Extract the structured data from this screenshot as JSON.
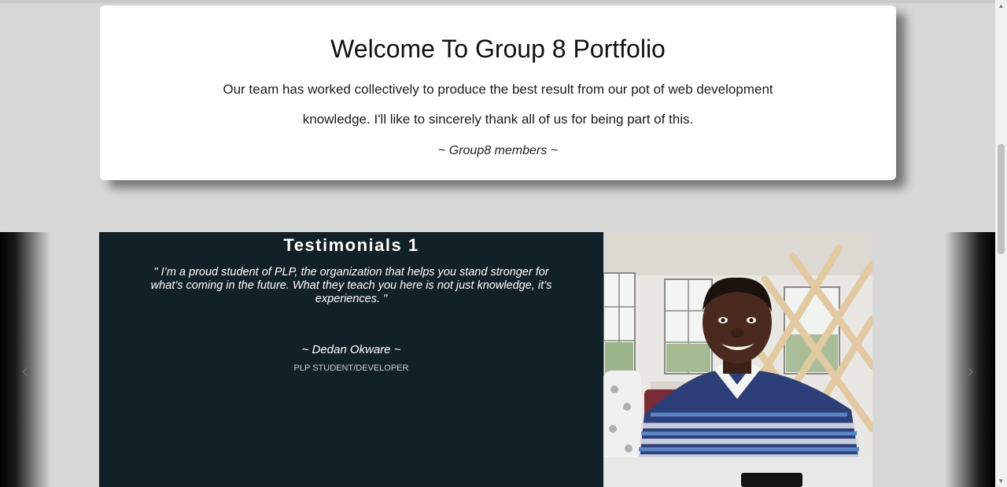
{
  "welcome": {
    "title": "Welcome To Group 8 Portfolio",
    "text": "Our team has worked collectively to produce the best result from our pot of web development knowledge. I'll like to sincerely thank all of us for being part of this.",
    "signature": "~ Group8 members ~"
  },
  "testimonial": {
    "title": "Testimonials 1",
    "quote": "\" I’m a proud student of PLP, the organization that helps you stand stronger for what’s coming in the future. What they teach you here is not just knowledge, it’s experiences. \"",
    "author": "~ Dedan Okware ~",
    "role": "PLP STUDENT/DEVELOPER"
  },
  "carousel": {
    "prev_icon": "chevron-left-icon",
    "next_icon": "chevron-right-icon",
    "prev_glyph": "‹",
    "next_glyph": "›"
  },
  "colors": {
    "page_bg": "#d6d7d6",
    "card_bg": "#ffffff",
    "slide_bg": "#122027"
  }
}
